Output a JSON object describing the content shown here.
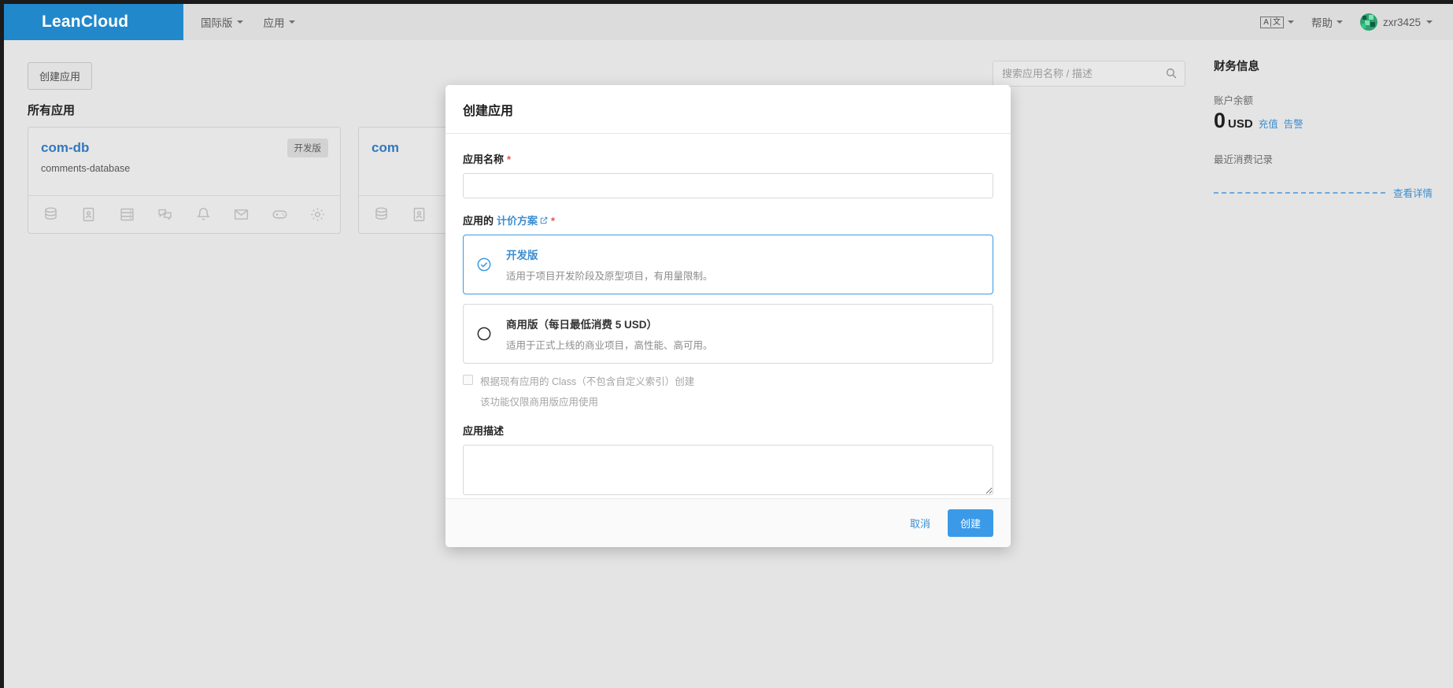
{
  "navbar": {
    "brand": "LeanCloud",
    "links": [
      {
        "label": "国际版",
        "name": "nav-region"
      },
      {
        "label": "应用",
        "name": "nav-apps"
      }
    ],
    "lang_glyph_left": "A",
    "lang_glyph_right": "文",
    "help_label": "帮助",
    "user_name": "zxr3425"
  },
  "main": {
    "create_app_button": "创建应用",
    "section_title": "所有应用",
    "search_placeholder": "搜索应用名称 / 描述",
    "cards": [
      {
        "name": "com-db",
        "description": "comments-database",
        "badge": "开发版"
      },
      {
        "name": "com",
        "description": "",
        "badge": ""
      }
    ],
    "card_icons": [
      "database-icon",
      "contacts-icon",
      "storage-icon",
      "chat-icon",
      "bell-icon",
      "mail-icon",
      "game-icon",
      "gear-icon"
    ]
  },
  "sidebar": {
    "title": "财务信息",
    "balance_label": "账户余额",
    "balance_value": "0",
    "balance_currency": "USD",
    "recharge_link": "充值",
    "alert_link": "告警",
    "recent_label": "最近消费记录",
    "detail_link": "查看详情"
  },
  "modal": {
    "title": "创建应用",
    "app_name_label": "应用名称",
    "app_name_value": "",
    "required_mark": "*",
    "plan_label_prefix": "应用的",
    "plan_label_link": "计价方案",
    "plans": [
      {
        "title": "开发版",
        "desc": "适用于项目开发阶段及原型项目，有用量限制。",
        "selected": true
      },
      {
        "title": "商用版（每日最低消费 5 USD）",
        "desc": "适用于正式上线的商业项目，高性能、高可用。",
        "selected": false
      }
    ],
    "clone_checkbox_label": "根据现有应用的 Class（不包含自定义索引）创建",
    "clone_checkbox_sub": "该功能仅限商用版应用使用",
    "clone_checked": false,
    "description_label": "应用描述",
    "description_value": "",
    "cancel_button": "取消",
    "create_button": "创建"
  },
  "colors": {
    "brand_blue": "#2288cc",
    "accent_blue": "#3b9ae8",
    "link_blue": "#3b8ed0",
    "required_red": "#e4554e",
    "page_bg": "#e4e4e4"
  }
}
